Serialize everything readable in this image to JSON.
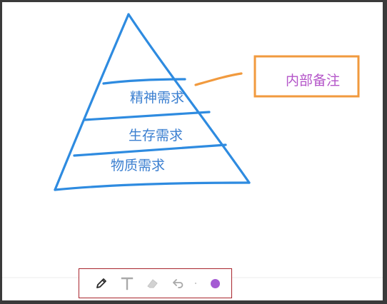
{
  "canvas": {
    "background": "#ffffff",
    "frame_color": "#3a3a3a"
  },
  "pyramid": {
    "stroke_color": "#2e8be0",
    "levels": [
      {
        "label": "精神需求"
      },
      {
        "label": "生存需求"
      },
      {
        "label": "物质需求"
      }
    ]
  },
  "annotation": {
    "text": "内部备注",
    "text_color": "#b455c9",
    "border_color": "#f19a3e",
    "connector_color": "#f19a3e"
  },
  "toolbar": {
    "highlight_border": "#a8252d",
    "tools": [
      {
        "name": "pen-icon",
        "active": true
      },
      {
        "name": "text-icon",
        "active": false
      },
      {
        "name": "eraser-icon",
        "active": false
      },
      {
        "name": "undo-icon",
        "active": false
      }
    ],
    "current_color": "#a45bd3"
  }
}
